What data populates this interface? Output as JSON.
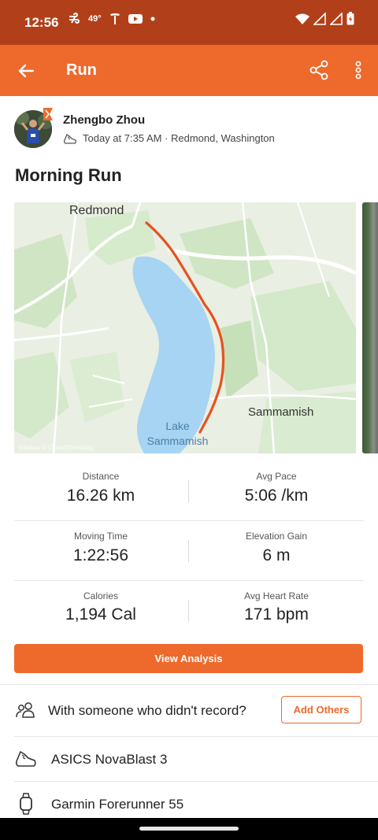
{
  "status_bar": {
    "time": "12:56",
    "temperature": "49°",
    "icons_left": [
      "wind-icon",
      "tesla-icon",
      "youtube-icon",
      "dot-icon"
    ],
    "icons_right": [
      "wifi-icon",
      "signal-icon",
      "signal-icon",
      "battery-icon"
    ],
    "background": "#b1401a"
  },
  "app_bar": {
    "title": "Run",
    "background": "#ed6a2c"
  },
  "athlete": {
    "name": "Zhengbo Zhou",
    "activity_meta": "Today at 7:35 AM · Redmond, Washington"
  },
  "activity": {
    "title": "Morning Run"
  },
  "map": {
    "labels": {
      "city_redmond": "Redmond",
      "city_sammamish": "Sammamish",
      "lake_line1": "Lake",
      "lake_line2": "Sammamish",
      "attribution": "Mapbox © OpenStreetMap"
    },
    "route_color": "#e8511f"
  },
  "stats": [
    {
      "label": "Distance",
      "value": "16.26 km"
    },
    {
      "label": "Avg Pace",
      "value": "5:06 /km"
    },
    {
      "label": "Moving Time",
      "value": "1:22:56"
    },
    {
      "label": "Elevation Gain",
      "value": "6 m"
    },
    {
      "label": "Calories",
      "value": "1,194 Cal"
    },
    {
      "label": "Avg Heart Rate",
      "value": "171 bpm"
    }
  ],
  "actions": {
    "view_analysis": "View Analysis",
    "with_someone": "With someone who didn't record?",
    "add_others": "Add Others"
  },
  "gear": {
    "shoes": "ASICS NovaBlast 3",
    "device": "Garmin Forerunner 55"
  },
  "colors": {
    "accent": "#ed6a2c"
  }
}
